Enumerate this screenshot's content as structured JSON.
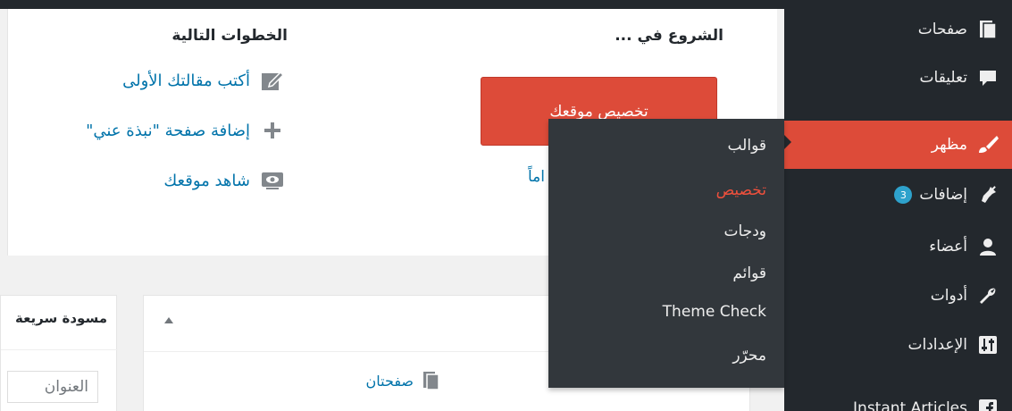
{
  "sidebar": {
    "items": [
      {
        "label": "صفحات",
        "icon": "pages-icon"
      },
      {
        "label": "تعليقات",
        "icon": "comments-icon"
      },
      {
        "label": "مظهر",
        "icon": "appearance-brush-icon",
        "active": true
      },
      {
        "label": "إضافات",
        "icon": "plugins-icon",
        "badge": "3"
      },
      {
        "label": "أعضاء",
        "icon": "users-icon"
      },
      {
        "label": "أدوات",
        "icon": "tools-wrench-icon"
      },
      {
        "label": "الإعدادات",
        "icon": "settings-sliders-icon"
      },
      {
        "label": "Instant Articles",
        "icon": "facebook-icon"
      }
    ]
  },
  "submenu": {
    "items": [
      {
        "label": "قوالب",
        "current": false
      },
      {
        "label": "تخصيص",
        "current": true
      },
      {
        "label": "ودجات",
        "current": false
      },
      {
        "label": "قوائم",
        "current": false
      },
      {
        "label": "Theme Check",
        "current": false
      },
      {
        "label": "محرّر",
        "current": false
      }
    ]
  },
  "welcome": {
    "get_started_title": "الشروع في ...",
    "customize_button": "تخصيص موقعك",
    "partial_link": "اماً",
    "next_steps_title": "الخطوات التالية",
    "next_steps": [
      {
        "label": "أكتب مقالتك الأولى",
        "icon": "edit-icon"
      },
      {
        "label": "إضافة صفحة \"نبذة عني\"",
        "icon": "plus-icon"
      },
      {
        "label": "شاهد موقعك",
        "icon": "view-screen-icon"
      }
    ]
  },
  "quick_draft": {
    "title": "مسودة سريعة",
    "title_placeholder": "العنوان"
  },
  "at_a_glance": {
    "pages_link": "صفحتان"
  },
  "colors": {
    "sidebar_bg": "#23282d",
    "active": "#dd4b39",
    "submenu_bg": "#32373c",
    "current_sub": "#f0503c",
    "link": "#0073aa",
    "badge": "#2ea2cc"
  }
}
